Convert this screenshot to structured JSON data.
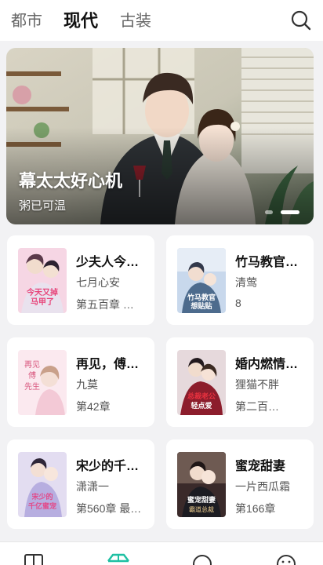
{
  "tabs": [
    {
      "label": "都市",
      "active": false
    },
    {
      "label": "现代",
      "active": true
    },
    {
      "label": "古装",
      "active": false
    }
  ],
  "banner": {
    "title": "幕太太好心机",
    "subtitle": "粥已可温",
    "slide_count": 2,
    "active_slide": 2
  },
  "books": [
    {
      "title": "少夫人今天又掉马甲了",
      "author": "七月心安",
      "chapter": "第五百章 …",
      "cover_text": "今天又掉马甲"
    },
    {
      "title": "竹马教官一想贴贴",
      "author": "清莺",
      "chapter": "8",
      "cover_text": "竹马教官想贴贴"
    },
    {
      "title": "再见，傅先生",
      "author": "九莫",
      "chapter": "第42章",
      "cover_text": "再见傅先生"
    },
    {
      "title": "婚内燃情总裁老公轻点爱",
      "author": "狸猫不胖",
      "chapter": "第二百…",
      "cover_text": "总裁老公轻点爱"
    },
    {
      "title": "宋少的千亿蜜宠",
      "author": "潇潇一",
      "chapter": "第560章 最…",
      "cover_text": "宋少的千亿蜜宠"
    },
    {
      "title": "蜜宠甜妻",
      "author": "一片西瓜霜",
      "chapter": "第166章",
      "cover_text": "蜜宠甜妻"
    }
  ],
  "colors": {
    "accent": "#1fc0a3",
    "background": "#f2f2f4"
  },
  "icons": {
    "search": "search-icon",
    "nav": [
      "bookshelf-icon",
      "discover-icon",
      "category-icon",
      "profile-icon"
    ]
  }
}
